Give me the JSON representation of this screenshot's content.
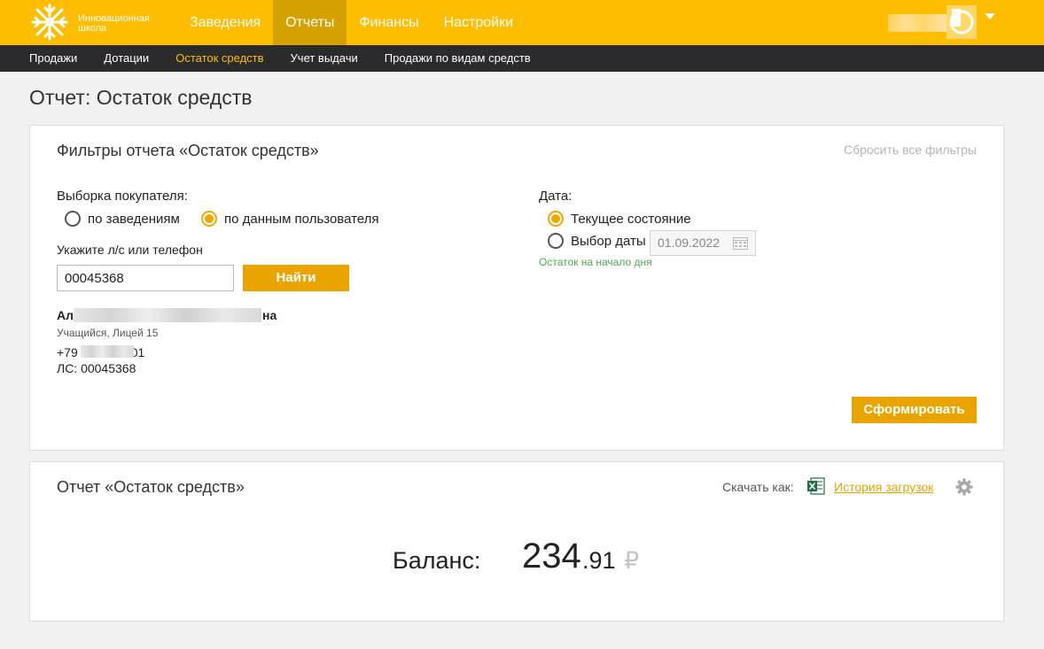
{
  "brand": {
    "line1": "Инновационная",
    "line2": "школа"
  },
  "main_nav": [
    {
      "label": "Заведения",
      "active": false
    },
    {
      "label": "Отчеты",
      "active": true
    },
    {
      "label": "Финансы",
      "active": false
    },
    {
      "label": "Настройки",
      "active": false
    }
  ],
  "sub_nav": [
    {
      "label": "Продажи",
      "active": false
    },
    {
      "label": "Дотации",
      "active": false
    },
    {
      "label": "Остаток средств",
      "active": true
    },
    {
      "label": "Учет выдачи",
      "active": false
    },
    {
      "label": "Продажи по видам средств",
      "active": false
    }
  ],
  "page_title": "Отчет: Остаток средств",
  "filters": {
    "heading": "Фильтры отчета «Остаток средств»",
    "reset_label": "Сбросить все фильтры",
    "buyer_selection_label": "Выборка покупателя:",
    "buyer_options": [
      {
        "label": "по заведениям",
        "checked": false
      },
      {
        "label": "по данным пользователя",
        "checked": true
      }
    ],
    "account_field_label": "Укажите л/с или телефон",
    "account_value": "00045368",
    "find_button": "Найти",
    "user": {
      "name_start": "Ал",
      "name_end": "на",
      "subtitle": "Учащийся, Лицей 15",
      "phone_start": "+79",
      "phone_end": "01",
      "account": "ЛС: 00045368"
    },
    "date_label": "Дата:",
    "date_options": [
      {
        "label": "Текущее состояние",
        "checked": true
      },
      {
        "label": "Выбор даты",
        "checked": false
      }
    ],
    "date_value": "01.09.2022",
    "date_hint": "Остаток на начало дня",
    "generate_button": "Сформировать"
  },
  "report": {
    "heading": "Отчет «Остаток средств»",
    "download_label": "Скачать как:",
    "history_link": "История загрузок",
    "balance_label": "Баланс:",
    "balance_integer": "234",
    "balance_fraction": ".91",
    "currency": "₽"
  },
  "colors": {
    "accent": "#ffbd00",
    "button": "#e9a400",
    "subnav_bg": "#2b2b2b",
    "hint_green": "#4ea84e"
  },
  "icons": [
    "logo-snowflake-icon",
    "user-avatar-icon",
    "chevron-down-icon",
    "calendar-icon",
    "excel-icon",
    "gear-icon"
  ]
}
